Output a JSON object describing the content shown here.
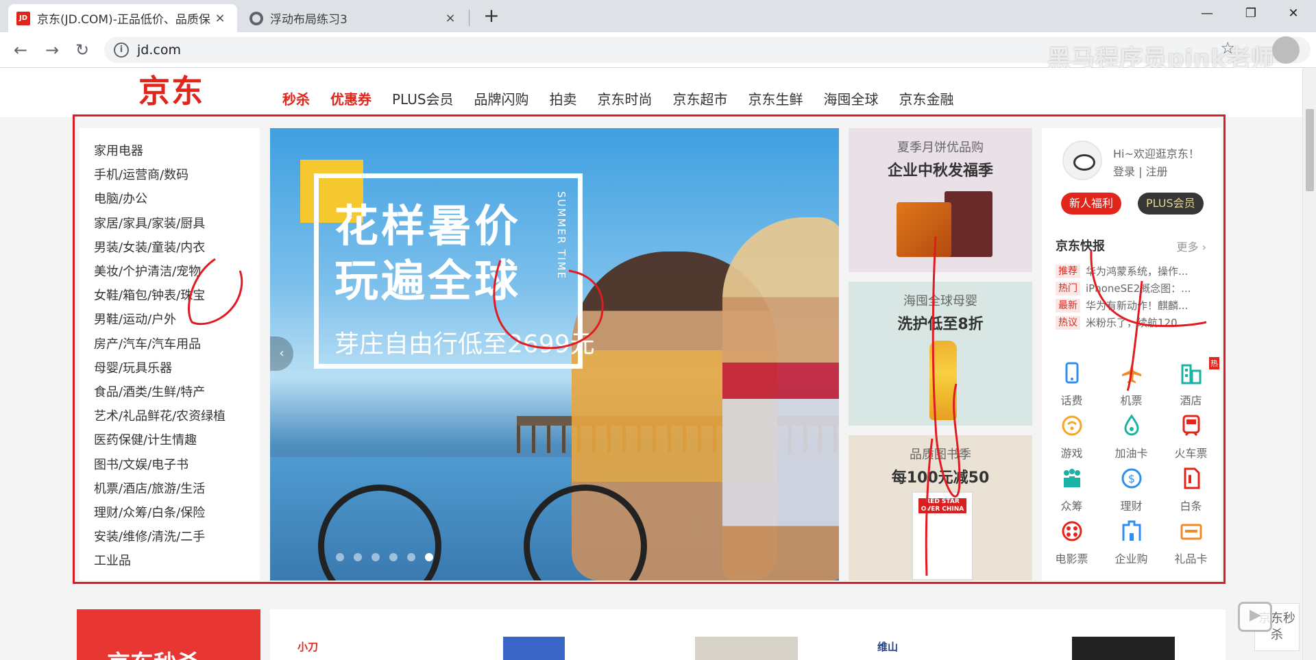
{
  "browser": {
    "tabs": [
      {
        "title": "京东(JD.COM)-正品低价、品质保",
        "favicon": "jd-favicon",
        "favicon_text": "JD",
        "close": "×"
      },
      {
        "title": "浮动布局练习3",
        "favicon": "globe-favicon",
        "close": "×"
      }
    ],
    "new_tab": "+",
    "window_controls": {
      "minimize": "—",
      "restore": "❐",
      "close": "✕"
    },
    "nav": {
      "back": "←",
      "forward": "→",
      "reload": "↻"
    },
    "url": "jd.com",
    "site_info": "i",
    "watermark": "黑马程序员pink老师",
    "star": "☆"
  },
  "page": {
    "logo": "京东",
    "nav_links": [
      {
        "label": "秒杀",
        "hot": true
      },
      {
        "label": "优惠券",
        "hot": true
      },
      {
        "label": "PLUS会员",
        "hot": false
      },
      {
        "label": "品牌闪购",
        "hot": false
      },
      {
        "label": "拍卖",
        "hot": false
      },
      {
        "label": "京东时尚",
        "hot": false
      },
      {
        "label": "京东超市",
        "hot": false
      },
      {
        "label": "京东生鲜",
        "hot": false
      },
      {
        "label": "海囤全球",
        "hot": false
      },
      {
        "label": "京东金融",
        "hot": false
      }
    ],
    "categories": [
      "家用电器",
      "手机/运营商/数码",
      "电脑/办公",
      "家居/家具/家装/厨具",
      "男装/女装/童装/内衣",
      "美妆/个护清洁/宠物",
      "女鞋/箱包/钟表/珠宝",
      "男鞋/运动/户外",
      "房产/汽车/汽车用品",
      "母婴/玩具乐器",
      "食品/酒类/生鲜/特产",
      "艺术/礼品鲜花/农资绿植",
      "医药保健/计生情趣",
      "图书/文娱/电子书",
      "机票/酒店/旅游/生活",
      "理财/众筹/白条/保险",
      "安装/维修/清洗/二手",
      "工业品"
    ],
    "banner": {
      "title_line1": "花样暑价",
      "title_line2": "玩遍全球",
      "vertical_text": "SUMMER TIME",
      "subtitle": "芽庄自由行低至2699元",
      "prev_arrow": "‹",
      "dots": 6,
      "active_dot": 5
    },
    "promos": [
      {
        "subtitle": "夏季月饼优品购",
        "title": "企业中秋发福季"
      },
      {
        "subtitle": "海囤全球母婴",
        "title": "洗护低至8折"
      },
      {
        "subtitle": "品质图书季",
        "title": "每100元减50",
        "book_text": "RED STAR OVER CHINA"
      }
    ],
    "user": {
      "greeting": "Hi~欢迎逛京东！",
      "login": "登录 | 注册",
      "new_user_btn": "新人福利",
      "plus_btn": "PLUS会员"
    },
    "express": {
      "title": "京东快报",
      "more": "更多 ›",
      "items": [
        {
          "tag": "推荐",
          "text": "华为鸿蒙系统，操作..."
        },
        {
          "tag": "热门",
          "text": "iPhoneSE2概念图：..."
        },
        {
          "tag": "最新",
          "text": "华为有新动作！麒麟..."
        },
        {
          "tag": "热议",
          "text": "米粉乐了，续航120..."
        }
      ]
    },
    "services": [
      {
        "label": "话费",
        "icon": "phone-icon",
        "color": "#2e8ff0"
      },
      {
        "label": "机票",
        "icon": "plane-icon",
        "color": "#f08a24"
      },
      {
        "label": "酒店",
        "icon": "hotel-icon",
        "color": "#19b3a6",
        "badge": "热"
      },
      {
        "label": "游戏",
        "icon": "game-icon",
        "color": "#f6a623"
      },
      {
        "label": "加油卡",
        "icon": "fuel-icon",
        "color": "#19b3a6"
      },
      {
        "label": "火车票",
        "icon": "train-icon",
        "color": "#e1251b"
      },
      {
        "label": "众筹",
        "icon": "crowdfund-icon",
        "color": "#19b3a6"
      },
      {
        "label": "理财",
        "icon": "finance-icon",
        "color": "#2e8ff0"
      },
      {
        "label": "白条",
        "icon": "credit-icon",
        "color": "#e1251b"
      },
      {
        "label": "电影票",
        "icon": "movie-icon",
        "color": "#e1251b"
      },
      {
        "label": "企业购",
        "icon": "enterprise-icon",
        "color": "#2e8ff0"
      },
      {
        "label": "礼品卡",
        "icon": "giftcard-icon",
        "color": "#f08a24"
      }
    ],
    "seckill_title": "京东秒杀",
    "fixed_seckill": "京东秒杀",
    "strip_brands": [
      "小刀",
      "维山"
    ]
  },
  "colors": {
    "jd_red": "#e1251b",
    "highlight_box": "#e11b22",
    "annotation_ink": "#e11b22"
  }
}
